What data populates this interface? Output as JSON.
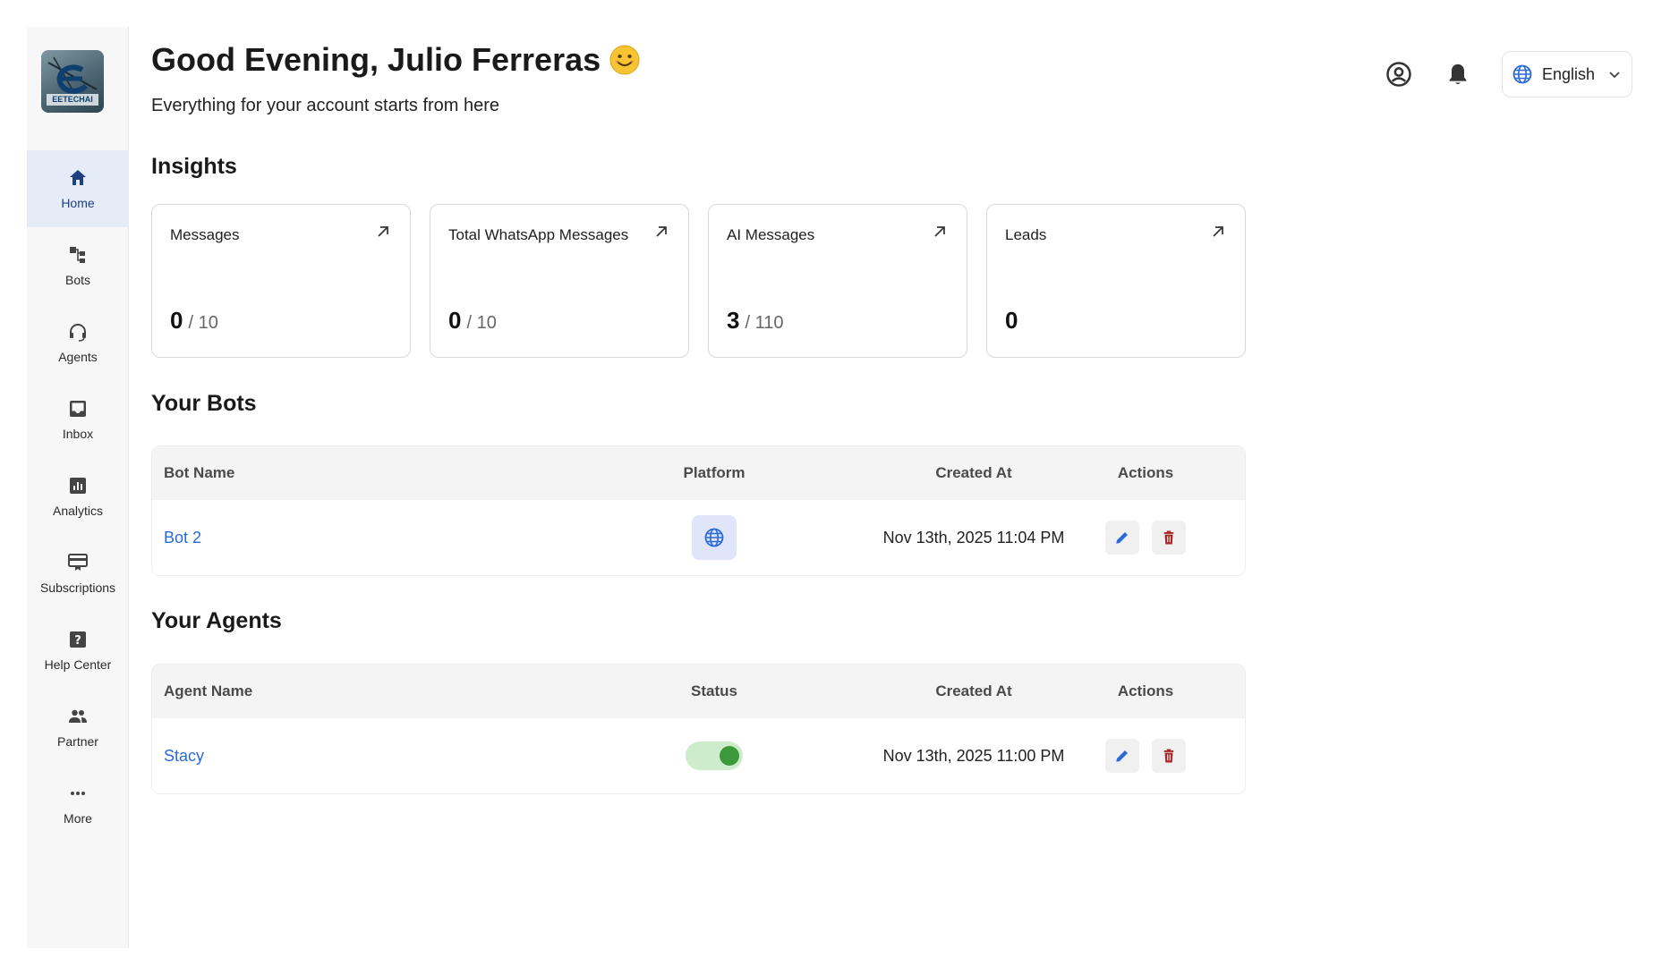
{
  "brand": {
    "logo_text": "EETECHAI"
  },
  "sidebar": {
    "items": [
      {
        "label": "Home",
        "icon": "home-icon",
        "active": true
      },
      {
        "label": "Bots",
        "icon": "bots-icon",
        "active": false
      },
      {
        "label": "Agents",
        "icon": "headset-icon",
        "active": false
      },
      {
        "label": "Inbox",
        "icon": "inbox-icon",
        "active": false
      },
      {
        "label": "Analytics",
        "icon": "analytics-icon",
        "active": false
      },
      {
        "label": "Subscriptions",
        "icon": "subscriptions-icon",
        "active": false
      },
      {
        "label": "Help Center",
        "icon": "help-icon",
        "active": false
      },
      {
        "label": "Partner",
        "icon": "partner-icon",
        "active": false
      },
      {
        "label": "More",
        "icon": "more-icon",
        "active": false
      }
    ]
  },
  "header": {
    "greeting": "Good Evening, Julio Ferreras",
    "subtitle": "Everything for your account starts from here",
    "language": "English"
  },
  "insights": {
    "title": "Insights",
    "cards": [
      {
        "label": "Messages",
        "value": "0",
        "limit": "/ 10"
      },
      {
        "label": "Total WhatsApp Messages",
        "value": "0",
        "limit": "/ 10"
      },
      {
        "label": "AI Messages",
        "value": "3",
        "limit": "/ 110"
      },
      {
        "label": "Leads",
        "value": "0",
        "limit": ""
      }
    ]
  },
  "bots": {
    "title": "Your Bots",
    "columns": [
      "Bot Name",
      "Platform",
      "Created At",
      "Actions"
    ],
    "rows": [
      {
        "name": "Bot 2",
        "platform_icon": "globe-icon",
        "created_at": "Nov 13th, 2025 11:04 PM"
      }
    ]
  },
  "agents": {
    "title": "Your Agents",
    "columns": [
      "Agent Name",
      "Status",
      "Created At",
      "Actions"
    ],
    "rows": [
      {
        "name": "Stacy",
        "status_on": true,
        "created_at": "Nov 13th, 2025 11:00 PM"
      }
    ]
  },
  "colors": {
    "accent": "#2a6ad6",
    "active_nav_bg": "#e6ecf7",
    "delete": "#a52a2a",
    "toggle_on": "#3d9a3b"
  }
}
